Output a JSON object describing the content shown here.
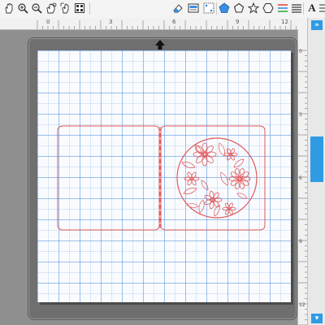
{
  "toolbar": {
    "tools": [
      "pan-hand-icon",
      "zoom-in-icon",
      "zoom-out-icon",
      "zoom-drag-icon",
      "fit-to-page-icon"
    ],
    "right_tools": [
      "eraser-icon",
      "image-trace-icon",
      "point-edit-icon",
      "pentagon-shape-icon",
      "polygon-icon",
      "star-icon",
      "hexagon-icon",
      "line-style-icon",
      "align-icon",
      "text-icon",
      "list-icon"
    ]
  },
  "ruler": {
    "top_labels": [
      "0",
      "3",
      "6",
      "9",
      "12"
    ],
    "right_labels": [
      "0",
      "3",
      "6",
      "9",
      "12"
    ]
  },
  "colors": {
    "design_line": "#e2585a",
    "grid_major": "#5a8cd8",
    "scroll_accent": "#2f9be3"
  }
}
